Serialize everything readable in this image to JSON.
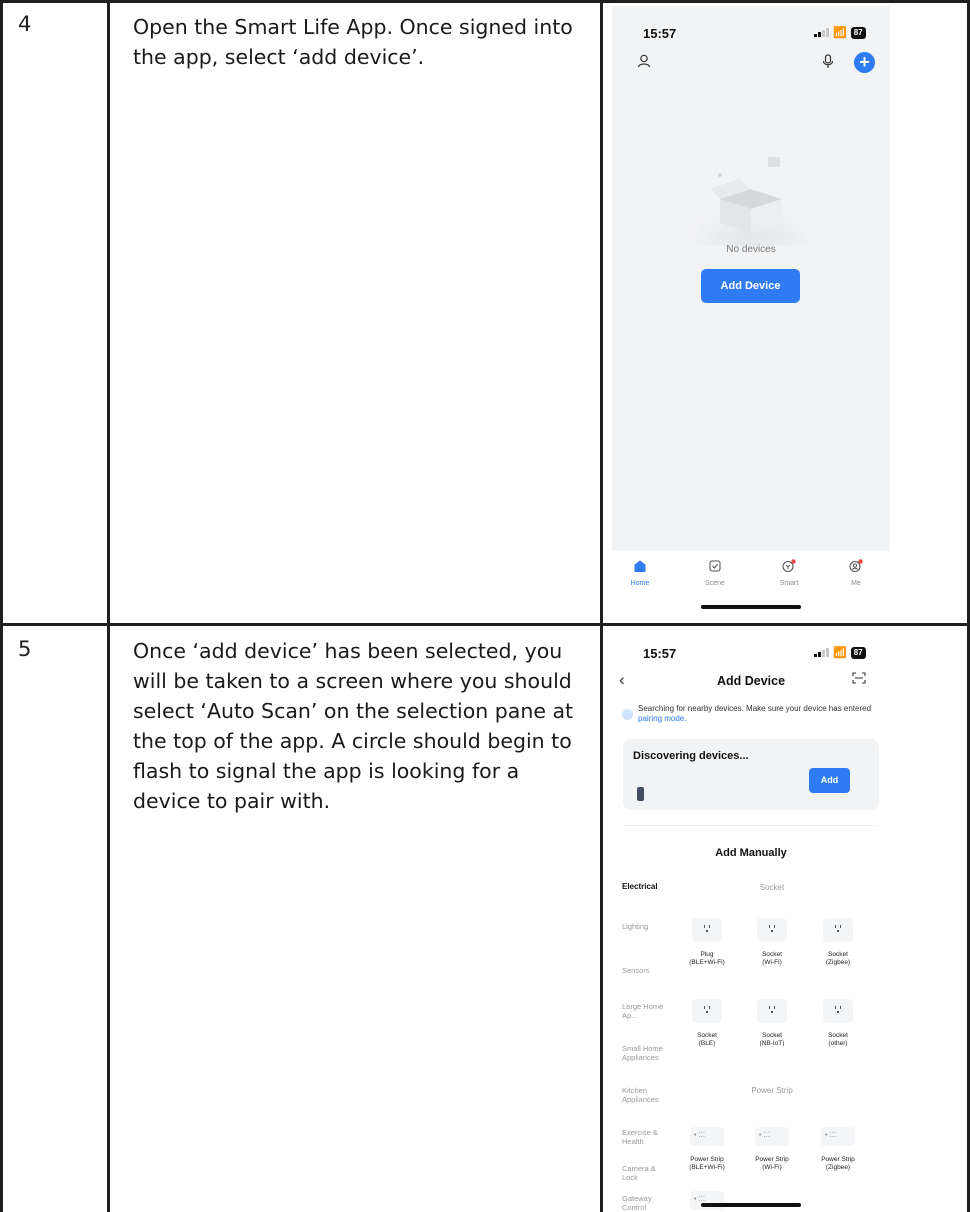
{
  "rows": [
    {
      "step": "4",
      "description": "Open the Smart Life App. Once signed into the app, select ‘add device’.",
      "screen": {
        "time": "15:57",
        "battery": "87",
        "empty_text": "No devices",
        "add_button": "Add Device",
        "tabs": [
          {
            "label": "Home",
            "icon": "home-icon"
          },
          {
            "label": "Scene",
            "icon": "scene-icon"
          },
          {
            "label": "Smart",
            "icon": "smart-icon"
          },
          {
            "label": "Me",
            "icon": "user-icon"
          }
        ]
      }
    },
    {
      "step": "5",
      "description": "Once ‘add device’ has been selected, you will be taken to a screen where you should select ‘Auto Scan’ on the selection pane at the top of the app. A circle should begin to flash to signal the app is looking for a device to pair with.",
      "screen": {
        "time": "15:57",
        "battery": "87",
        "title": "Add Device",
        "search_text": "Searching for nearby devices. Make sure your device has entered ",
        "search_link": "pairing mode.",
        "discover_title": "Discovering devices...",
        "discover_add": "Add",
        "manual_title": "Add Manually",
        "categories": [
          "Electrical",
          "Lighting",
          "Sensors",
          "Large Home Ap...",
          "Small Home Appliances",
          "Kitchen Appliances",
          "Exercise & Health",
          "Camera & Lock",
          "Gateway Control"
        ],
        "section_socket": "Socket",
        "section_strip": "Power Strip",
        "socket_devices": [
          [
            "Plug",
            "(BLE+Wi-Fi)"
          ],
          [
            "Socket",
            "(Wi-Fi)"
          ],
          [
            "Socket",
            "(Zigbee)"
          ],
          [
            "Socket",
            "(BLE)"
          ],
          [
            "Socket",
            "(NB-IoT)"
          ],
          [
            "Socket",
            "(other)"
          ]
        ],
        "strip_devices": [
          [
            "Power Strip",
            "(BLE+Wi-Fi)"
          ],
          [
            "Power Strip",
            "(Wi-Fi)"
          ],
          [
            "Power Strip",
            "(Zigbee)"
          ]
        ]
      }
    }
  ]
}
